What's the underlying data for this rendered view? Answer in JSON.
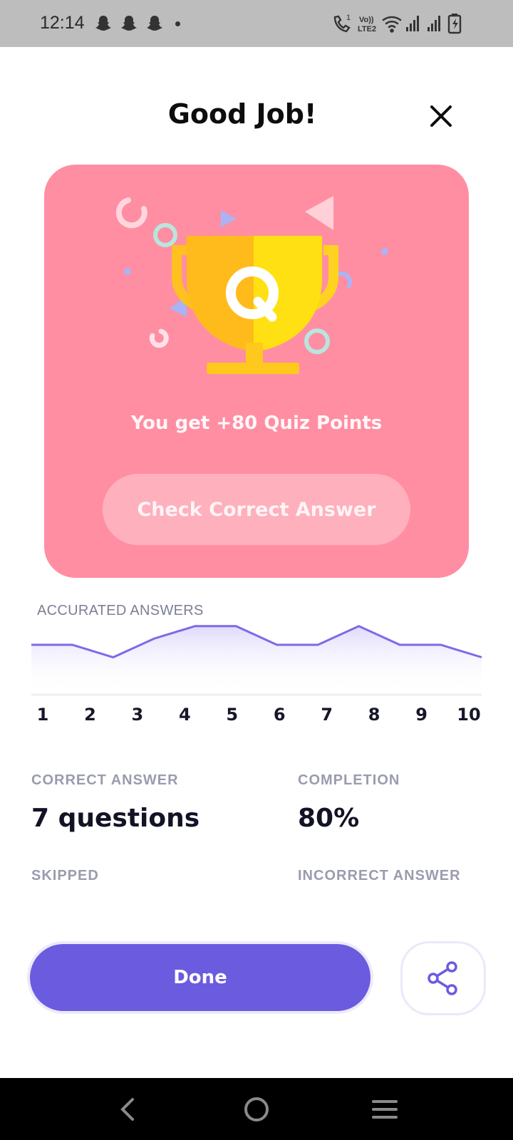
{
  "status_bar": {
    "time": "12:14",
    "left_icons": [
      "snapchat-icon",
      "snapchat-icon",
      "snapchat-icon",
      "dot-icon"
    ],
    "right_icons": [
      "call-icon",
      "volte-icon",
      "wifi-icon",
      "signal-icon",
      "signal-icon",
      "battery-charging-icon"
    ],
    "volte_text": "Vo)) LTE2"
  },
  "header": {
    "title": "Good Job!",
    "close_icon": "close-icon"
  },
  "result_card": {
    "background_color": "#ff8ea3",
    "trophy_icon": "trophy-icon",
    "points_text": "You get +80 Quiz Points",
    "check_button_label": "Check Correct Answer"
  },
  "accuracy": {
    "label": "ACCURATED ANSWERS",
    "line_color": "#7a6be6"
  },
  "chart_data": {
    "type": "area",
    "x": [
      "1",
      "2",
      "3",
      "4",
      "5",
      "6",
      "7",
      "8",
      "9",
      "10"
    ],
    "series": [
      {
        "values": [
          2,
          2,
          1,
          2.5,
          3.5,
          3.5,
          2,
          2,
          3.5,
          2,
          2,
          1
        ]
      }
    ],
    "x_positions_note": "",
    "ylim": [
      0,
      4
    ],
    "grid": false
  },
  "stats": {
    "correct_label": "CORRECT ANSWER",
    "correct_value": "7 questions",
    "completion_label": "COMPLETION",
    "completion_value": "80%",
    "skipped_label": "SKIPPED",
    "incorrect_label": "INCORRECT ANSWER"
  },
  "footer": {
    "done_label": "Done",
    "share_icon": "share-icon",
    "accent_color": "#6b5bdf"
  },
  "nav_bar": {
    "icons": [
      "back-icon",
      "home-icon",
      "recents-icon"
    ]
  }
}
